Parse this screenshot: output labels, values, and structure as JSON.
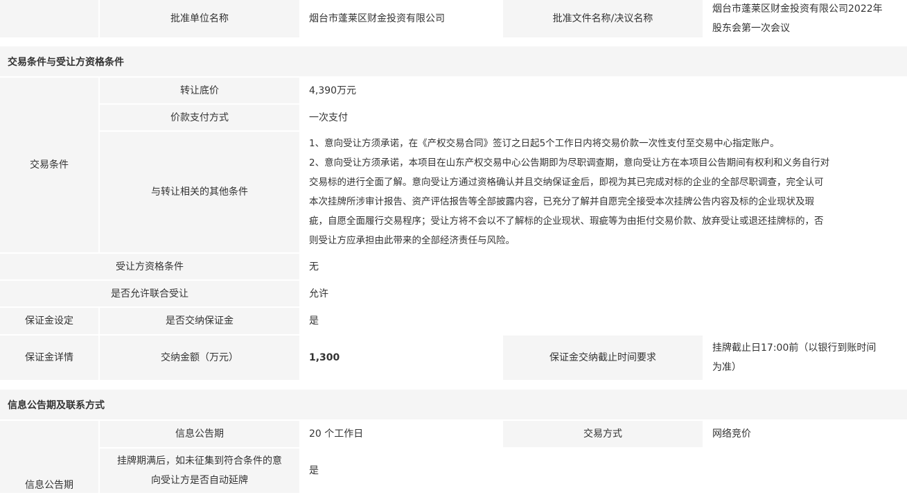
{
  "approval": {
    "unit_label": "批准单位名称",
    "unit_value": "烟台市蓬莱区财金投资有限公司",
    "doc_label": "批准文件名称/决议名称",
    "doc_value": "烟台市蓬莱区财金投资有限公司2022年\n股东会第一次会议"
  },
  "trade_section": {
    "title": "交易条件与受让方资格条件",
    "group_label": "交易条件",
    "rows": [
      {
        "label": "转让底价",
        "value": "4,390万元"
      },
      {
        "label": "价款支付方式",
        "value": "一次支付"
      },
      {
        "label": "与转让相关的其他条件",
        "value": "1、意向受让方须承诺，在《产权交易合同》签订之日起5个工作日内将交易价款一次性支付至交易中心指定账户。\n2、意向受让方须承诺，本项目在山东产权交易中心公告期即为尽职调查期，意向受让方在本项目公告期间有权利和义务自行对\n交易标的进行全面了解。意向受让方通过资格确认并且交纳保证金后，即视为其已完成对标的企业的全部尽职调查，完全认可\n本次挂牌所涉审计报告、资产评估报告等全部披露内容，已充分了解并自愿完全接受本次挂牌公告内容及标的企业现状及瑕\n疵，自愿全面履行交易程序；受让方将不会以不了解标的企业现状、瑕疵等为由拒付交易价款、放弃受让或退还挂牌标的，否\n则受让方应承担由此带来的全部经济责任与风险。"
      },
      {
        "label": "受让方资格条件",
        "value": "无"
      },
      {
        "label": "是否允许联合受让",
        "value": "允许"
      }
    ],
    "deposit_setting": {
      "group": "保证金设定",
      "label": "是否交纳保证金",
      "value": "是"
    },
    "deposit_detail": {
      "group": "保证金详情",
      "amount_label": "交纳金额（万元）",
      "amount_value": "1,300",
      "deadline_label": "保证金交纳截止时间要求",
      "deadline_value": "挂牌截止日17:00前（以银行到账时间\n为准）"
    }
  },
  "info_section": {
    "title": "信息公告期及联系方式",
    "group_label": "信息公告期",
    "period_label": "信息公告期",
    "period_value": "20 个工作日",
    "method_label": "交易方式",
    "method_value": "网络竞价",
    "extend_label": "挂牌期满后，如未征集到符合条件的意\n向受让方是否自动延牌",
    "extend_value": "是"
  }
}
